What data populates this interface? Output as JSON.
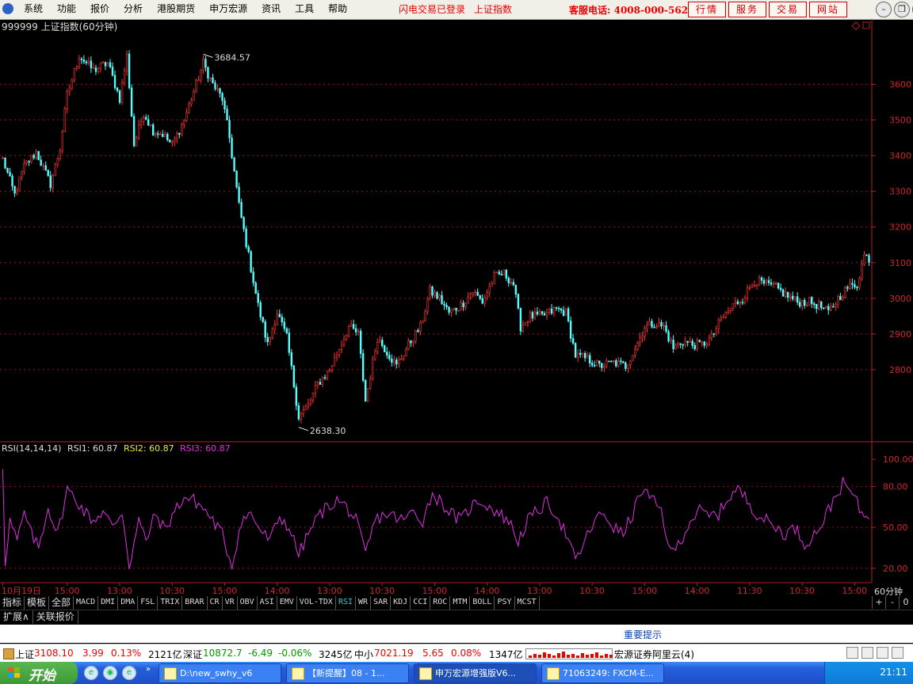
{
  "menubar": {
    "items": [
      "系统",
      "功能",
      "报价",
      "分析",
      "港股期货",
      "申万宏源",
      "资讯",
      "工具",
      "帮助"
    ],
    "login_status": "闪电交易已登录",
    "login_index": "上证指数",
    "hotline": "客服电话: 4008-000-562",
    "buttons": [
      "行情",
      "服务",
      "交易",
      "网站"
    ]
  },
  "chart_header": {
    "title": "999999 上证指数(60分钟)",
    "rsi_params": "RSI(14,14,14)",
    "rsi1": "RSI1: 60.87",
    "rsi2": "RSI2: 60.87",
    "rsi3": "RSI3: 60.87",
    "period": "60分钟"
  },
  "chart_data": [
    {
      "type": "candlestick",
      "title": "999999 上证指数(60分钟)",
      "y_ticks": [
        "3600",
        "3500",
        "3400",
        "3300",
        "3200",
        "3100",
        "3000",
        "2900",
        "2800"
      ],
      "ylim": [
        2620,
        3730
      ],
      "annotations": [
        {
          "text": "3684.57",
          "x_index": 84,
          "value": 3684.57
        },
        {
          "text": "2638.30",
          "x_index": 124,
          "value": 2638.3
        }
      ],
      "x_ticks": [
        "10月19日",
        "15:00",
        "13:00",
        "10:30",
        "15:00",
        "14:00",
        "13:00",
        "10:30",
        "15:00",
        "14:00",
        "13:00",
        "10:30",
        "15:00",
        "14:00",
        "11:30",
        "10:30",
        "15:00"
      ],
      "x_tick_indices": [
        0,
        27,
        49,
        71,
        93,
        115,
        137,
        159,
        181,
        203,
        225,
        247,
        269,
        291,
        313,
        335,
        357
      ],
      "n_bars": 364,
      "keypoints": [
        [
          0,
          3390
        ],
        [
          5,
          3290
        ],
        [
          9,
          3370
        ],
        [
          14,
          3410
        ],
        [
          20,
          3320
        ],
        [
          24,
          3420
        ],
        [
          27,
          3570
        ],
        [
          32,
          3680
        ],
        [
          38,
          3640
        ],
        [
          44,
          3660
        ],
        [
          49,
          3560
        ],
        [
          52,
          3680
        ],
        [
          55,
          3430
        ],
        [
          59,
          3520
        ],
        [
          63,
          3470
        ],
        [
          67,
          3460
        ],
        [
          71,
          3430
        ],
        [
          76,
          3500
        ],
        [
          80,
          3580
        ],
        [
          84,
          3660
        ],
        [
          88,
          3600
        ],
        [
          92,
          3560
        ],
        [
          95,
          3450
        ],
        [
          99,
          3260
        ],
        [
          103,
          3120
        ],
        [
          107,
          2980
        ],
        [
          111,
          2870
        ],
        [
          115,
          2960
        ],
        [
          119,
          2890
        ],
        [
          124,
          2668
        ],
        [
          128,
          2700
        ],
        [
          132,
          2760
        ],
        [
          137,
          2800
        ],
        [
          141,
          2860
        ],
        [
          145,
          2920
        ],
        [
          149,
          2900
        ],
        [
          152,
          2712
        ],
        [
          157,
          2890
        ],
        [
          161,
          2850
        ],
        [
          165,
          2810
        ],
        [
          170,
          2870
        ],
        [
          175,
          2920
        ],
        [
          179,
          3020
        ],
        [
          183,
          3000
        ],
        [
          187,
          2960
        ],
        [
          192,
          2980
        ],
        [
          197,
          3020
        ],
        [
          201,
          2990
        ],
        [
          206,
          3060
        ],
        [
          210,
          3070
        ],
        [
          214,
          3040
        ],
        [
          217,
          2920
        ],
        [
          221,
          2950
        ],
        [
          226,
          2950
        ],
        [
          232,
          2970
        ],
        [
          236,
          2960
        ],
        [
          240,
          2840
        ],
        [
          245,
          2830
        ],
        [
          250,
          2810
        ],
        [
          256,
          2820
        ],
        [
          261,
          2810
        ],
        [
          265,
          2860
        ],
        [
          269,
          2920
        ],
        [
          273,
          2930
        ],
        [
          277,
          2920
        ],
        [
          281,
          2860
        ],
        [
          285,
          2880
        ],
        [
          289,
          2870
        ],
        [
          293,
          2870
        ],
        [
          297,
          2890
        ],
        [
          301,
          2940
        ],
        [
          306,
          2980
        ],
        [
          310,
          3000
        ],
        [
          315,
          3050
        ],
        [
          319,
          3040
        ],
        [
          324,
          3030
        ],
        [
          328,
          3010
        ],
        [
          333,
          2990
        ],
        [
          338,
          2990
        ],
        [
          342,
          2980
        ],
        [
          346,
          2960
        ],
        [
          350,
          3000
        ],
        [
          354,
          3030
        ],
        [
          358,
          3040
        ],
        [
          361,
          3120
        ],
        [
          364,
          3108
        ]
      ]
    },
    {
      "type": "line",
      "title": "RSI(14,14,14)",
      "y_ticks": [
        "100.00",
        "80.00",
        "50.00",
        "20.00"
      ],
      "ylim": [
        10,
        103
      ],
      "series": [
        {
          "name": "RSI3",
          "value_last": 60.87,
          "color": "#e030e0"
        }
      ],
      "keypoints": [
        [
          0,
          95
        ],
        [
          1,
          25
        ],
        [
          3,
          55
        ],
        [
          6,
          40
        ],
        [
          9,
          60
        ],
        [
          12,
          45
        ],
        [
          15,
          35
        ],
        [
          19,
          65
        ],
        [
          23,
          45
        ],
        [
          27,
          78
        ],
        [
          31,
          70
        ],
        [
          34,
          62
        ],
        [
          38,
          55
        ],
        [
          42,
          62
        ],
        [
          46,
          50
        ],
        [
          50,
          62
        ],
        [
          53,
          22
        ],
        [
          57,
          55
        ],
        [
          60,
          40
        ],
        [
          64,
          60
        ],
        [
          68,
          48
        ],
        [
          72,
          62
        ],
        [
          76,
          72
        ],
        [
          80,
          70
        ],
        [
          84,
          64
        ],
        [
          88,
          55
        ],
        [
          92,
          45
        ],
        [
          96,
          22
        ],
        [
          100,
          55
        ],
        [
          104,
          60
        ],
        [
          108,
          48
        ],
        [
          112,
          40
        ],
        [
          116,
          58
        ],
        [
          120,
          50
        ],
        [
          124,
          30
        ],
        [
          128,
          45
        ],
        [
          132,
          58
        ],
        [
          136,
          65
        ],
        [
          140,
          70
        ],
        [
          144,
          65
        ],
        [
          148,
          55
        ],
        [
          152,
          30
        ],
        [
          156,
          55
        ],
        [
          160,
          60
        ],
        [
          164,
          58
        ],
        [
          168,
          55
        ],
        [
          172,
          62
        ],
        [
          176,
          55
        ],
        [
          180,
          75
        ],
        [
          184,
          68
        ],
        [
          188,
          60
        ],
        [
          192,
          55
        ],
        [
          196,
          65
        ],
        [
          200,
          70
        ],
        [
          204,
          65
        ],
        [
          208,
          60
        ],
        [
          212,
          55
        ],
        [
          216,
          40
        ],
        [
          220,
          55
        ],
        [
          224,
          62
        ],
        [
          228,
          68
        ],
        [
          232,
          60
        ],
        [
          236,
          45
        ],
        [
          240,
          25
        ],
        [
          244,
          40
        ],
        [
          248,
          55
        ],
        [
          252,
          60
        ],
        [
          256,
          50
        ],
        [
          260,
          45
        ],
        [
          264,
          60
        ],
        [
          268,
          78
        ],
        [
          272,
          70
        ],
        [
          276,
          62
        ],
        [
          280,
          30
        ],
        [
          284,
          40
        ],
        [
          288,
          55
        ],
        [
          292,
          62
        ],
        [
          296,
          58
        ],
        [
          300,
          60
        ],
        [
          304,
          72
        ],
        [
          308,
          78
        ],
        [
          312,
          70
        ],
        [
          316,
          60
        ],
        [
          320,
          55
        ],
        [
          324,
          50
        ],
        [
          328,
          45
        ],
        [
          332,
          50
        ],
        [
          336,
          38
        ],
        [
          340,
          45
        ],
        [
          344,
          55
        ],
        [
          348,
          70
        ],
        [
          352,
          82
        ],
        [
          356,
          75
        ],
        [
          360,
          60
        ],
        [
          364,
          61
        ]
      ]
    }
  ],
  "toolbar": {
    "tabs": [
      "指标",
      "模板",
      "全部",
      "MACD",
      "DMI",
      "DMA",
      "FSL",
      "TRIX",
      "BRAR",
      "CR",
      "VR",
      "OBV",
      "ASI",
      "EMV",
      "VOL-TDX",
      "RSI",
      "WR",
      "SAR",
      "KDJ",
      "CCI",
      "ROC",
      "MTM",
      "BOLL",
      "PSY",
      "MCST"
    ],
    "active": "RSI",
    "side_buttons": [
      "+",
      "-",
      "0"
    ],
    "sub_tabs": [
      "扩展\u0000",
      "关联报价"
    ]
  },
  "notice": "重要提示",
  "ticker": {
    "sh_label": "上证",
    "sh_value": "3108.10",
    "sh_change": "3.99",
    "sh_pct": "0.13%",
    "sh_amount": "2121亿",
    "sz_label": "深证",
    "sz_value": "10872.7",
    "sz_change": "-6.49",
    "sz_pct": "-0.06%",
    "sz_amount": "3245亿",
    "zx_label": "中小",
    "zx_value": "7021.19",
    "zx_change": "5.65",
    "zx_pct": "0.08%",
    "zx_amount": "1347亿",
    "broker": "宏源证券阿里云(4)"
  },
  "taskbar": {
    "start": "开始",
    "tasks": [
      "D:\\new_swhy_v6",
      "【新提醒】08 - 1...",
      "申万宏源增强版V6...",
      "71063249: FXCM-E..."
    ],
    "clock": "21:11"
  }
}
